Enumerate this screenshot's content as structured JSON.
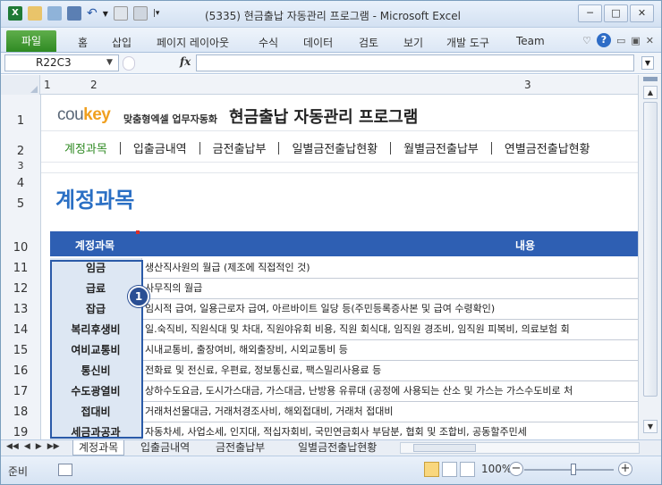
{
  "window": {
    "title": "(5335) 현금출납 자동관리 프로그램 - Microsoft Excel",
    "controls": {
      "minimize": "─",
      "restore": "□",
      "close": "✕"
    }
  },
  "ribbon": {
    "file_tab": "파일",
    "tabs": [
      "홈",
      "삽입",
      "페이지 레이아웃",
      "수식",
      "데이터",
      "검토",
      "보기",
      "개발 도구",
      "Team"
    ],
    "help": "?"
  },
  "formula_bar": {
    "name_box": "R22C3",
    "fx": "fx",
    "formula": ""
  },
  "columns": {
    "c1": "1",
    "c2": "2",
    "c3": "3"
  },
  "rows": [
    "1",
    "2",
    "3",
    "4",
    "5",
    "10",
    "11",
    "12",
    "13",
    "14",
    "15",
    "16",
    "17",
    "18",
    "19"
  ],
  "header": {
    "logo_brand": "cou",
    "logo_brand_accent": "key",
    "logo_tagline": "맞춤형엑셀 업무자동화",
    "app_title": "현금출납 자동관리 프로그램"
  },
  "nav": [
    "계정과목",
    "입출금내역",
    "금전출납부",
    "일별금전출납현황",
    "월별금전출납부",
    "연별금전출납현황"
  ],
  "page_heading": "계정과목",
  "table": {
    "col_account": "계정과목",
    "col_content": "내용",
    "rows": [
      {
        "account": "임금",
        "content": "생산직사원의 월급 (제조에 직접적인 것)"
      },
      {
        "account": "급료",
        "content": "사무직의 월급"
      },
      {
        "account": "잡급",
        "content": "임시적 급여, 일용근로자 급여, 아르바이트 일당 등(주민등록증사본 및 급여 수령확인)"
      },
      {
        "account": "복리후생비",
        "content": "일.숙직비, 직원식대 및 차대, 직원야유회 비용, 직원  회식대, 임직원 경조비, 임직원 피복비, 의료보험 회"
      },
      {
        "account": "여비교통비",
        "content": "시내교통비, 출장여비, 해외출장비, 시외교통비 등"
      },
      {
        "account": "통신비",
        "content": "전화료 및 전신료, 우편료, 정보통신료, 팩스밀리사용료  등"
      },
      {
        "account": "수도광열비",
        "content": "상하수도요금, 도시가스대금, 가스대금, 난방용 유류대 (공정에 사용되는 산소 및 가스는 가스수도비로 처"
      },
      {
        "account": "접대비",
        "content": "거래처선물대금, 거래처경조사비, 해외접대비, 거래처 접대비"
      },
      {
        "account": "세금과공과",
        "content": "자동차세, 사업소세, 인지대, 적십자회비, 국민연금회사 부담분, 협회 및 조합비, 공동할주민세"
      }
    ]
  },
  "callout": "1",
  "sheet_tabs": [
    "계정과목",
    "입출금내역",
    "금전출납부",
    "일별금전출납현황"
  ],
  "status": {
    "ready": "준비",
    "zoom": "100%"
  },
  "colors": {
    "accent_green": "#2f8a23",
    "heading_blue": "#2a6fc4",
    "table_header": "#2e5fb3",
    "account_cell": "#dde7f3",
    "logo_orange": "#f0a020"
  }
}
